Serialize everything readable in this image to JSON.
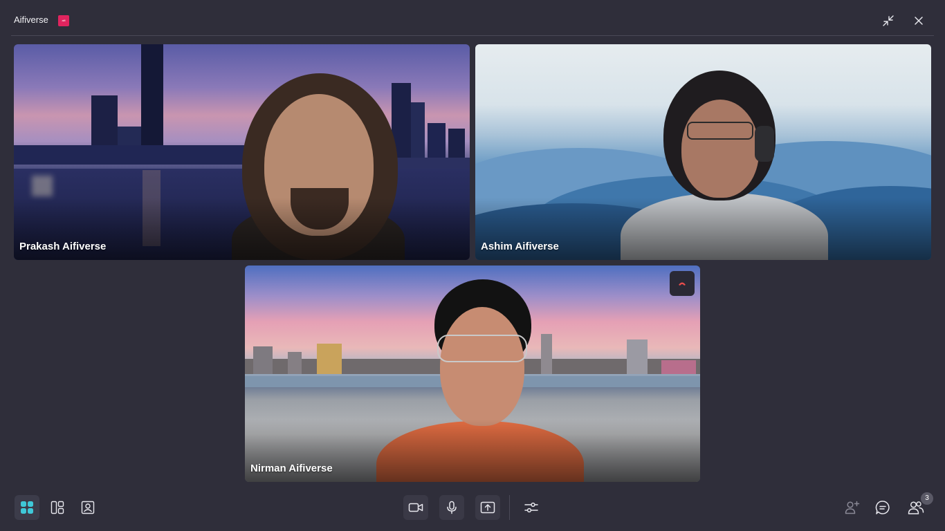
{
  "window": {
    "title": "Aifiverse",
    "badge_text": "aifi"
  },
  "participants": [
    {
      "name": "Prakash Aifiverse"
    },
    {
      "name": "Ashim Aifiverse"
    },
    {
      "name": "Nirman Aifiverse"
    }
  ],
  "toolbar": {
    "participants_count": "3"
  },
  "icons": {
    "minimize": "minimize-icon",
    "close": "close-icon",
    "grid_view": "grid-view-icon",
    "sidebar_layout": "sidebar-layout-icon",
    "speaker_view": "speaker-view-icon",
    "camera": "video-camera-icon",
    "microphone": "microphone-icon",
    "share_screen": "share-screen-icon",
    "settings": "sliders-icon",
    "add_participant": "add-person-icon",
    "chat": "chat-icon",
    "participants": "participants-icon"
  },
  "colors": {
    "background": "#2f2e3a",
    "active_accent": "#3fc8d8",
    "badge": "#e0245e",
    "end_call": "#e84c4c"
  }
}
